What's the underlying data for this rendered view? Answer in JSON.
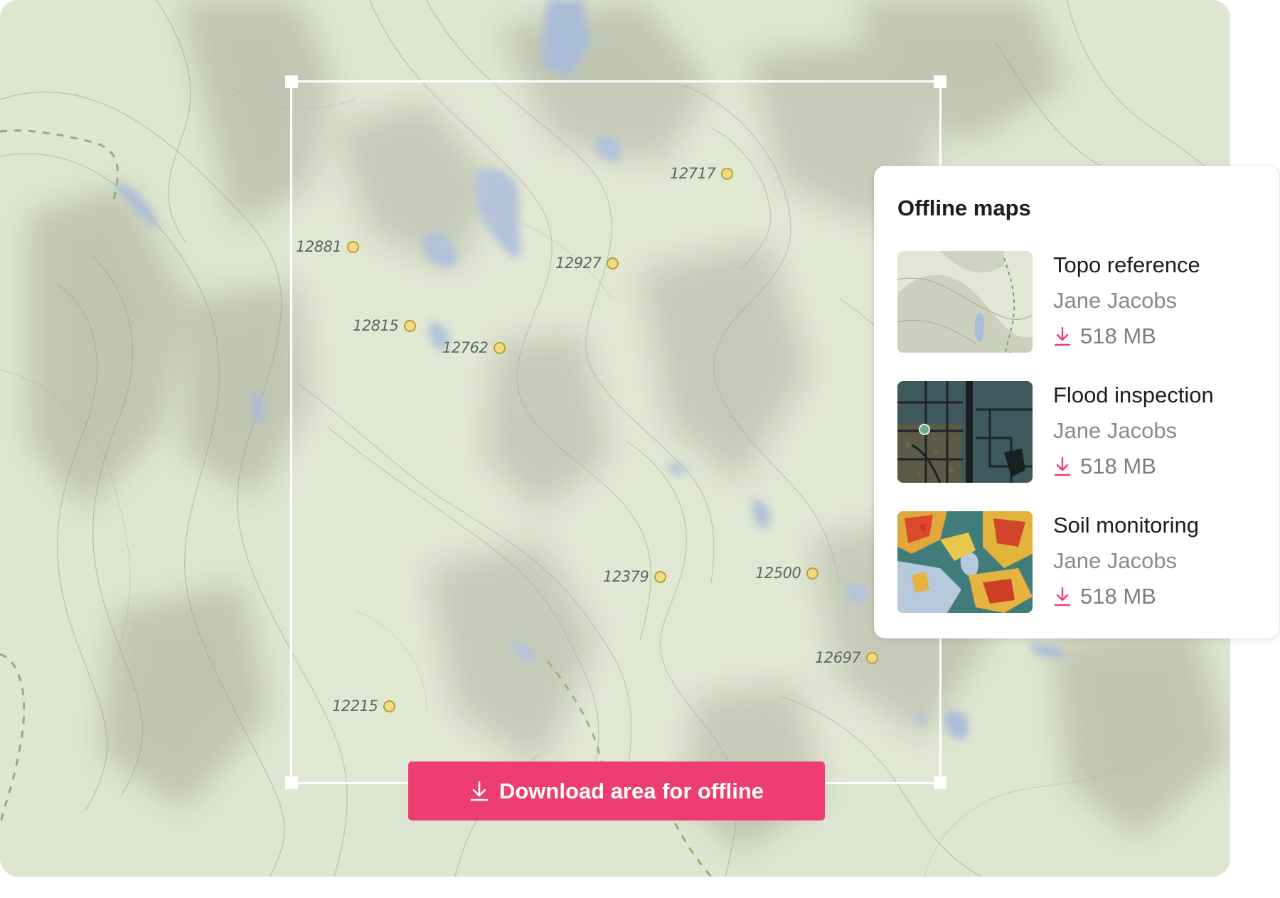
{
  "map": {
    "peaks": [
      "12717",
      "12881",
      "12927",
      "12815",
      "12762",
      "12379",
      "12500",
      "12697",
      "12215"
    ]
  },
  "download_button": {
    "label": "Download area for offline",
    "icon": "download-icon",
    "color": "#ee3d72"
  },
  "panel": {
    "title": "Offline maps",
    "items": [
      {
        "name": "Topo reference",
        "owner": "Jane Jacobs",
        "size": "518 MB",
        "thumbnail": "topo-thumbnail"
      },
      {
        "name": "Flood inspection",
        "owner": "Jane Jacobs",
        "size": "518 MB",
        "thumbnail": "satellite-thumbnail"
      },
      {
        "name": "Soil monitoring",
        "owner": "Jane Jacobs",
        "size": "518 MB",
        "thumbnail": "soil-heatmap-thumbnail"
      }
    ]
  },
  "colors": {
    "accent": "#ee3d72",
    "map_base": "#dfe5cf",
    "water": "#a9bcd8",
    "peak_marker": "#f3dc7f"
  }
}
